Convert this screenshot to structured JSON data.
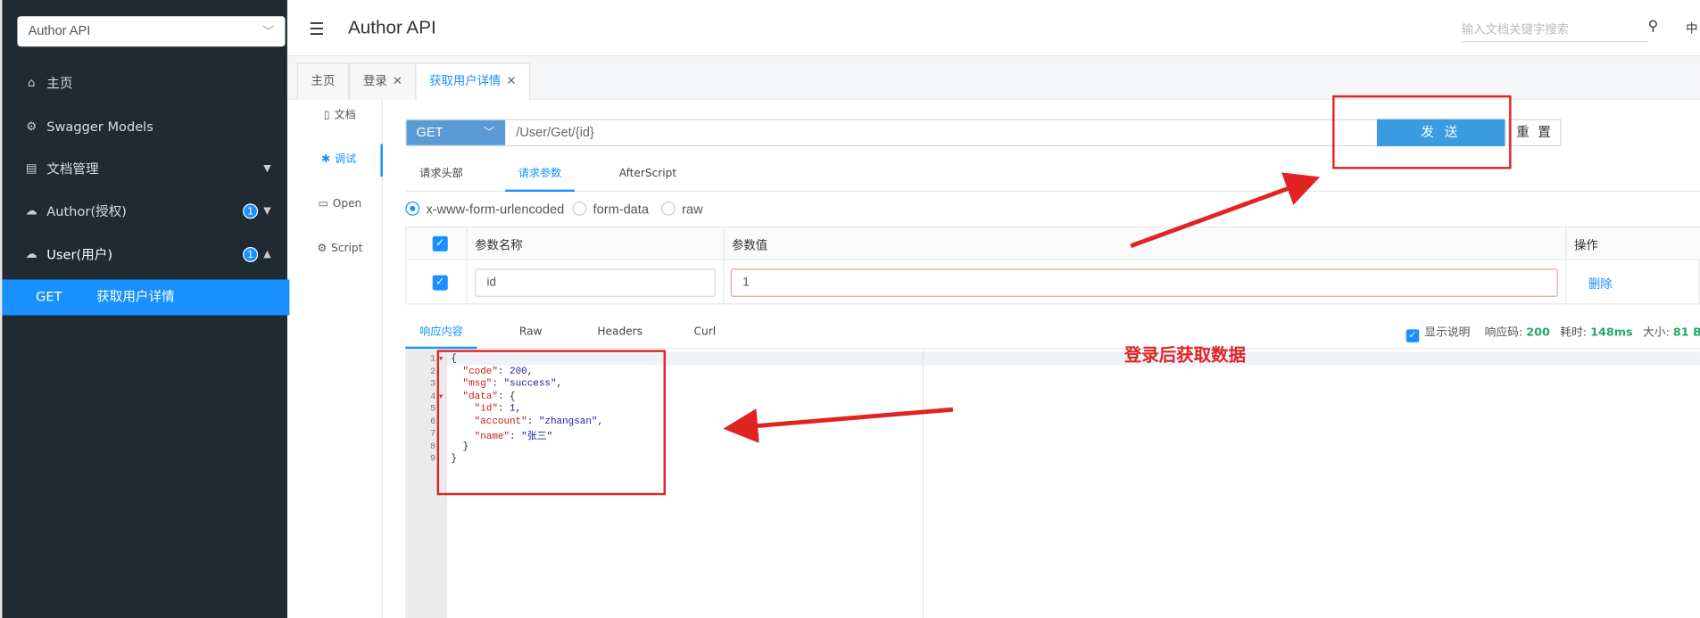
{
  "sidebar": {
    "project_select": "Author API",
    "items": [
      {
        "label": "主页",
        "icon": "home-icon"
      },
      {
        "label": "Swagger Models",
        "icon": "settings-icon"
      },
      {
        "label": "文档管理",
        "icon": "doc-manage-icon"
      },
      {
        "label": "Author(授权)",
        "icon": "cloud-icon",
        "badge": "1"
      },
      {
        "label": "User(用户)",
        "icon": "cloud-icon",
        "badge": "1"
      }
    ],
    "active_item": {
      "method": "GET",
      "label": "获取用户详情"
    }
  },
  "header": {
    "title": "Author API",
    "search_placeholder": "输入文档关键字搜索",
    "lang": "中"
  },
  "tabs": [
    {
      "label": "主页"
    },
    {
      "label": "登录",
      "closable": true
    },
    {
      "label": "获取用户详情",
      "closable": true,
      "active": true
    }
  ],
  "subnav": [
    {
      "label": "文档",
      "icon": "doc-icon"
    },
    {
      "label": "调试",
      "icon": "debug-icon",
      "active": true
    },
    {
      "label": "Open",
      "icon": "open-icon"
    },
    {
      "label": "Script",
      "icon": "script-icon"
    }
  ],
  "request": {
    "method": "GET",
    "url": "/User/Get/{id}",
    "send_label": "发 送",
    "reset_label": "重 置",
    "tabs": [
      "请求头部",
      "请求参数",
      "AfterScript"
    ],
    "active_tab": "请求参数",
    "content_types": [
      "x-www-form-urlencoded",
      "form-data",
      "raw"
    ],
    "selected_content_type": "x-www-form-urlencoded",
    "params_table": {
      "headers": [
        "参数名称",
        "参数值",
        "操作"
      ],
      "rows": [
        {
          "checked": true,
          "name": "id",
          "value": "1",
          "action": "删除"
        }
      ]
    }
  },
  "response": {
    "tabs": [
      "响应内容",
      "Raw",
      "Headers",
      "Curl"
    ],
    "active_tab": "响应内容",
    "show_desc_label": "显示说明",
    "status_label": "响应码:",
    "status_value": "200",
    "time_label": "耗时:",
    "time_value": "148ms",
    "size_label": "大小:",
    "size_value": "81 B",
    "body_lines": [
      "{",
      "  \"code\": 200,",
      "  \"msg\": \"success\",",
      "  \"data\": {",
      "    \"id\": 1,",
      "    \"account\": \"zhangsan\",",
      "    \"name\": \"张三\"",
      "  }",
      "}"
    ]
  },
  "annotation": {
    "text": "登录后获取数据",
    "color": "#e02424"
  },
  "colors": {
    "sidebar_bg": "#202a33",
    "accent": "#1890ff",
    "send_button": "#3a9be0"
  }
}
